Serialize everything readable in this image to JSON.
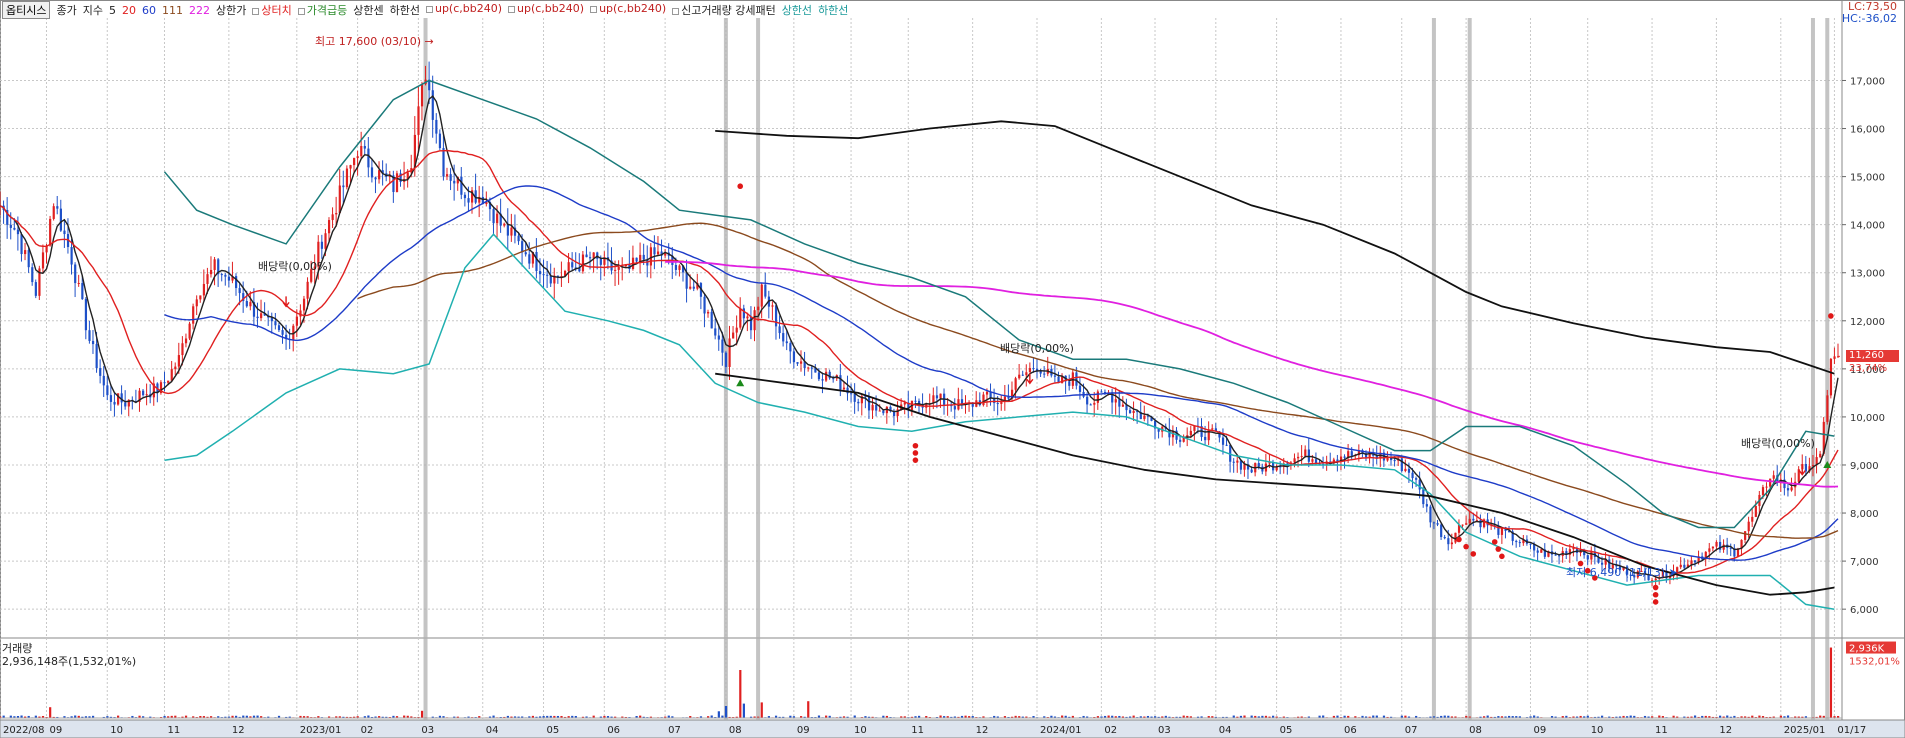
{
  "header": {
    "stock_name": "옵티시스",
    "label_close": "종가",
    "label_index": "지수",
    "ma_periods": [
      "5",
      "20",
      "60",
      "111",
      "222"
    ],
    "ma_colors": [
      "#222222",
      "#e02020",
      "#1e3cc8",
      "#8b4a1e",
      "#e020e0"
    ],
    "extra_items": [
      {
        "text": "상한가",
        "color": "#222222",
        "box": false
      },
      {
        "text": "상터치",
        "color": "#e02020",
        "box": true
      },
      {
        "text": "가격급등",
        "color": "#2a8a2a",
        "box": true
      },
      {
        "text": "상한센",
        "color": "#222222",
        "box": false
      },
      {
        "text": "하한선",
        "color": "#222222",
        "box": false
      },
      {
        "text": "up(c,bb240)",
        "color": "#c02020",
        "box": true
      },
      {
        "text": "up(c,bb240)",
        "color": "#c02020",
        "box": true
      },
      {
        "text": "up(c,bb240)",
        "color": "#c02020",
        "box": true
      },
      {
        "text": "신고거래량 강세패턴",
        "color": "#222222",
        "box": true
      },
      {
        "text": "상한선",
        "color": "#1a9a9a",
        "box": false
      },
      {
        "text": "하한선",
        "color": "#1a9a9a",
        "box": false
      }
    ]
  },
  "right_top": {
    "lc": "LC:73,50",
    "hc": "HC:-36,02"
  },
  "current": {
    "price_label": "11,260",
    "change_label": "23,74%",
    "volume_label": "2,936K",
    "volume_pct_label": "1532,01%"
  },
  "volume_panel": {
    "title": "거래량",
    "value_text": "2,936,148주(1,532,01%)"
  },
  "annotations": {
    "high": "최고 17,600 (03/10)",
    "low": "최저 6,490 (11/13)",
    "dividend_1": "배당락(0,00%)",
    "dividend_2": "배당락(0,00%)",
    "dividend_3": "배당락(0,00%)"
  },
  "colors": {
    "up": "#e02020",
    "down": "#1e50c8",
    "grid": "#c8c8c8",
    "axis_bg": "#dde4ee"
  },
  "chart_data": {
    "type": "candlestick",
    "y_axis": {
      "ticks": [
        6000,
        7000,
        8000,
        9000,
        10000,
        11000,
        12000,
        13000,
        14000,
        15000,
        16000,
        17000
      ],
      "tick_labels": [
        "6,000",
        "7,000",
        "8,000",
        "9,000",
        "10,000",
        "11,000",
        "12,000",
        "13,000",
        "14,000",
        "15,000",
        "16,000",
        "17,000"
      ],
      "ylim": [
        5400,
        18300
      ]
    },
    "x_axis": {
      "ticks": [
        {
          "t": 0,
          "label": "2022/08"
        },
        {
          "t": 13,
          "label": "09"
        },
        {
          "t": 30,
          "label": "10"
        },
        {
          "t": 46,
          "label": "11"
        },
        {
          "t": 64,
          "label": "12"
        },
        {
          "t": 83,
          "label": "2023/01"
        },
        {
          "t": 100,
          "label": "02"
        },
        {
          "t": 117,
          "label": "03"
        },
        {
          "t": 135,
          "label": "04"
        },
        {
          "t": 152,
          "label": "05"
        },
        {
          "t": 169,
          "label": "06"
        },
        {
          "t": 186,
          "label": "07"
        },
        {
          "t": 203,
          "label": "08"
        },
        {
          "t": 222,
          "label": "09"
        },
        {
          "t": 238,
          "label": "10"
        },
        {
          "t": 254,
          "label": "11"
        },
        {
          "t": 272,
          "label": "12"
        },
        {
          "t": 290,
          "label": "2024/01"
        },
        {
          "t": 308,
          "label": "02"
        },
        {
          "t": 323,
          "label": "03"
        },
        {
          "t": 340,
          "label": "04"
        },
        {
          "t": 357,
          "label": "05"
        },
        {
          "t": 375,
          "label": "06"
        },
        {
          "t": 392,
          "label": "07"
        },
        {
          "t": 410,
          "label": "08"
        },
        {
          "t": 428,
          "label": "09"
        },
        {
          "t": 444,
          "label": "10"
        },
        {
          "t": 462,
          "label": "11"
        },
        {
          "t": 480,
          "label": "12"
        },
        {
          "t": 498,
          "label": "2025/01"
        },
        {
          "t": 513,
          "label": "01/17"
        }
      ],
      "tmax": 514
    },
    "close_keypoints": [
      [
        0,
        14400
      ],
      [
        5,
        13800
      ],
      [
        10,
        12600
      ],
      [
        15,
        14500
      ],
      [
        20,
        13300
      ],
      [
        25,
        11600
      ],
      [
        30,
        10400
      ],
      [
        35,
        10300
      ],
      [
        40,
        10500
      ],
      [
        45,
        10600
      ],
      [
        50,
        11200
      ],
      [
        55,
        12600
      ],
      [
        60,
        13100
      ],
      [
        65,
        12800
      ],
      [
        70,
        12300
      ],
      [
        75,
        11900
      ],
      [
        80,
        11600
      ],
      [
        85,
        12500
      ],
      [
        90,
        13700
      ],
      [
        95,
        14600
      ],
      [
        100,
        15600
      ],
      [
        105,
        15100
      ],
      [
        110,
        14800
      ],
      [
        115,
        15400
      ],
      [
        119,
        17200
      ],
      [
        124,
        15200
      ],
      [
        130,
        14700
      ],
      [
        135,
        14600
      ],
      [
        140,
        14000
      ],
      [
        145,
        13600
      ],
      [
        150,
        13200
      ],
      [
        155,
        12900
      ],
      [
        160,
        13100
      ],
      [
        165,
        13300
      ],
      [
        170,
        13100
      ],
      [
        175,
        13000
      ],
      [
        180,
        13300
      ],
      [
        185,
        13400
      ],
      [
        190,
        13000
      ],
      [
        195,
        12600
      ],
      [
        200,
        11800
      ],
      [
        203,
        11200
      ],
      [
        207,
        12300
      ],
      [
        210,
        11900
      ],
      [
        213,
        12600
      ],
      [
        216,
        12200
      ],
      [
        220,
        11400
      ],
      [
        225,
        11100
      ],
      [
        230,
        10900
      ],
      [
        235,
        10700
      ],
      [
        240,
        10400
      ],
      [
        245,
        10200
      ],
      [
        250,
        10100
      ],
      [
        255,
        10200
      ],
      [
        260,
        10400
      ],
      [
        265,
        10300
      ],
      [
        270,
        10200
      ],
      [
        275,
        10400
      ],
      [
        280,
        10300
      ],
      [
        285,
        10800
      ],
      [
        290,
        11100
      ],
      [
        295,
        10700
      ],
      [
        300,
        10800
      ],
      [
        305,
        10300
      ],
      [
        310,
        10500
      ],
      [
        315,
        10200
      ],
      [
        320,
        10000
      ],
      [
        325,
        9800
      ],
      [
        330,
        9600
      ],
      [
        335,
        9700
      ],
      [
        340,
        9600
      ],
      [
        345,
        9100
      ],
      [
        350,
        8900
      ],
      [
        355,
        9000
      ],
      [
        360,
        9100
      ],
      [
        365,
        9200
      ],
      [
        370,
        9100
      ],
      [
        375,
        9200
      ],
      [
        380,
        9200
      ],
      [
        385,
        9200
      ],
      [
        390,
        9100
      ],
      [
        395,
        8800
      ],
      [
        400,
        7900
      ],
      [
        405,
        7400
      ],
      [
        410,
        7900
      ],
      [
        415,
        7800
      ],
      [
        420,
        7600
      ],
      [
        425,
        7400
      ],
      [
        430,
        7200
      ],
      [
        435,
        7100
      ],
      [
        440,
        7300
      ],
      [
        445,
        7100
      ],
      [
        450,
        6900
      ],
      [
        455,
        6800
      ],
      [
        460,
        6700
      ],
      [
        465,
        6700
      ],
      [
        470,
        6900
      ],
      [
        475,
        7100
      ],
      [
        480,
        7300
      ],
      [
        485,
        7200
      ],
      [
        490,
        7900
      ],
      [
        495,
        8800
      ],
      [
        500,
        8500
      ],
      [
        505,
        9000
      ],
      [
        509,
        9100
      ],
      [
        512,
        11260
      ],
      [
        513,
        11260
      ]
    ],
    "upper_envelope": [
      [
        46,
        15100
      ],
      [
        55,
        14300
      ],
      [
        65,
        14000
      ],
      [
        80,
        13600
      ],
      [
        95,
        15200
      ],
      [
        110,
        16600
      ],
      [
        120,
        17000
      ],
      [
        135,
        16600
      ],
      [
        150,
        16200
      ],
      [
        165,
        15600
      ],
      [
        180,
        14900
      ],
      [
        190,
        14300
      ],
      [
        200,
        14200
      ],
      [
        210,
        14100
      ],
      [
        225,
        13600
      ],
      [
        240,
        13200
      ],
      [
        255,
        12900
      ],
      [
        270,
        12500
      ],
      [
        285,
        11600
      ],
      [
        300,
        11200
      ],
      [
        315,
        11200
      ],
      [
        330,
        11000
      ],
      [
        345,
        10700
      ],
      [
        360,
        10300
      ],
      [
        375,
        9800
      ],
      [
        390,
        9300
      ],
      [
        400,
        9300
      ],
      [
        410,
        9800
      ],
      [
        425,
        9800
      ],
      [
        440,
        9400
      ],
      [
        455,
        8600
      ],
      [
        465,
        8000
      ],
      [
        475,
        7700
      ],
      [
        485,
        7700
      ],
      [
        495,
        8500
      ],
      [
        505,
        9700
      ],
      [
        513,
        9600
      ]
    ],
    "lower_envelope": [
      [
        46,
        9100
      ],
      [
        55,
        9200
      ],
      [
        65,
        9700
      ],
      [
        80,
        10500
      ],
      [
        95,
        11000
      ],
      [
        110,
        10900
      ],
      [
        120,
        11100
      ],
      [
        130,
        13100
      ],
      [
        138,
        13800
      ],
      [
        148,
        13000
      ],
      [
        158,
        12200
      ],
      [
        170,
        12000
      ],
      [
        180,
        11800
      ],
      [
        190,
        11500
      ],
      [
        200,
        10700
      ],
      [
        212,
        10300
      ],
      [
        225,
        10100
      ],
      [
        240,
        9800
      ],
      [
        255,
        9700
      ],
      [
        270,
        9900
      ],
      [
        285,
        10000
      ],
      [
        300,
        10100
      ],
      [
        315,
        10000
      ],
      [
        330,
        9600
      ],
      [
        345,
        9200
      ],
      [
        360,
        9000
      ],
      [
        375,
        9000
      ],
      [
        390,
        8900
      ],
      [
        400,
        8400
      ],
      [
        410,
        7600
      ],
      [
        425,
        7100
      ],
      [
        440,
        6800
      ],
      [
        455,
        6500
      ],
      [
        465,
        6600
      ],
      [
        475,
        6700
      ],
      [
        485,
        6700
      ],
      [
        495,
        6700
      ],
      [
        505,
        6100
      ],
      [
        513,
        6000
      ]
    ],
    "long_upper": [
      [
        200,
        15950
      ],
      [
        220,
        15850
      ],
      [
        240,
        15800
      ],
      [
        260,
        16000
      ],
      [
        280,
        16150
      ],
      [
        295,
        16050
      ],
      [
        310,
        15600
      ],
      [
        330,
        15000
      ],
      [
        350,
        14400
      ],
      [
        370,
        14000
      ],
      [
        390,
        13400
      ],
      [
        400,
        13000
      ],
      [
        410,
        12600
      ],
      [
        420,
        12300
      ],
      [
        440,
        11950
      ],
      [
        460,
        11650
      ],
      [
        480,
        11450
      ],
      [
        495,
        11350
      ],
      [
        505,
        11100
      ],
      [
        513,
        10900
      ]
    ],
    "long_lower": [
      [
        200,
        10900
      ],
      [
        220,
        10700
      ],
      [
        240,
        10500
      ],
      [
        260,
        10000
      ],
      [
        280,
        9600
      ],
      [
        300,
        9200
      ],
      [
        320,
        8900
      ],
      [
        340,
        8700
      ],
      [
        360,
        8600
      ],
      [
        380,
        8500
      ],
      [
        400,
        8350
      ],
      [
        420,
        8000
      ],
      [
        440,
        7500
      ],
      [
        460,
        6900
      ],
      [
        480,
        6500
      ],
      [
        495,
        6300
      ],
      [
        505,
        6350
      ],
      [
        513,
        6450
      ]
    ],
    "volume": {
      "max": 3000000,
      "spikes": [
        [
          14,
          450000
        ],
        [
          118,
          300000
        ],
        [
          201,
          280000
        ],
        [
          203,
          500000
        ],
        [
          207,
          2000000
        ],
        [
          208,
          600000
        ],
        [
          213,
          650000
        ],
        [
          226,
          700000
        ],
        [
          512,
          2936148
        ]
      ]
    },
    "volume_label_value": 2936148
  }
}
